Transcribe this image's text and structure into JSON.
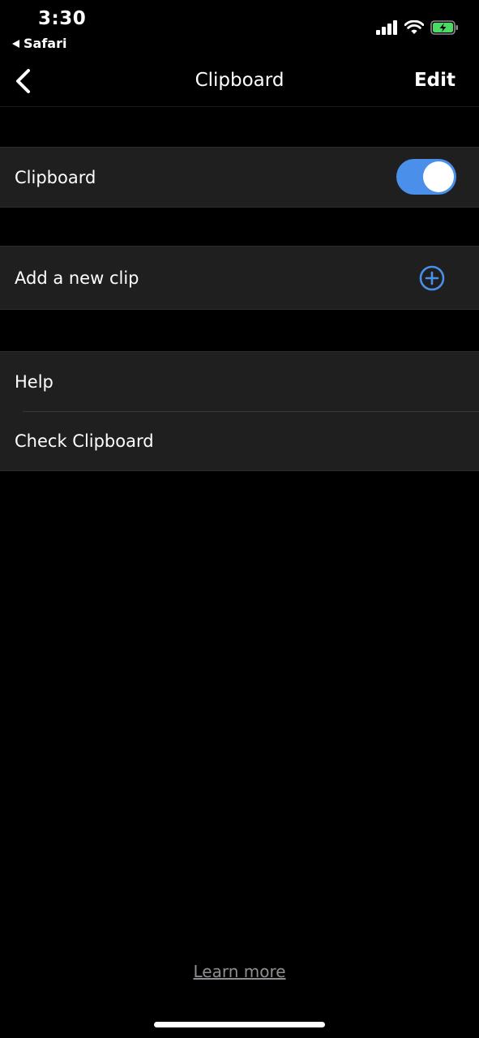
{
  "status_bar": {
    "time": "3:30",
    "back_app": "Safari",
    "icons": [
      "cellular-signal-icon",
      "wifi-icon",
      "battery-charging-icon"
    ],
    "battery_color": "#4cd964"
  },
  "nav": {
    "title": "Clipboard",
    "edit_label": "Edit",
    "back_icon": "chevron-left-icon"
  },
  "groups": {
    "toggle_group": {
      "label": "Clipboard",
      "toggle_on": true,
      "toggle_color": "#4a90ea"
    },
    "add_group": {
      "label": "Add a new clip",
      "icon": "plus-circle-icon",
      "icon_color": "#4a90ea"
    },
    "help_group": {
      "items": [
        {
          "label": "Help"
        },
        {
          "label": "Check Clipboard"
        }
      ]
    }
  },
  "footer": {
    "learn_more": "Learn more"
  }
}
